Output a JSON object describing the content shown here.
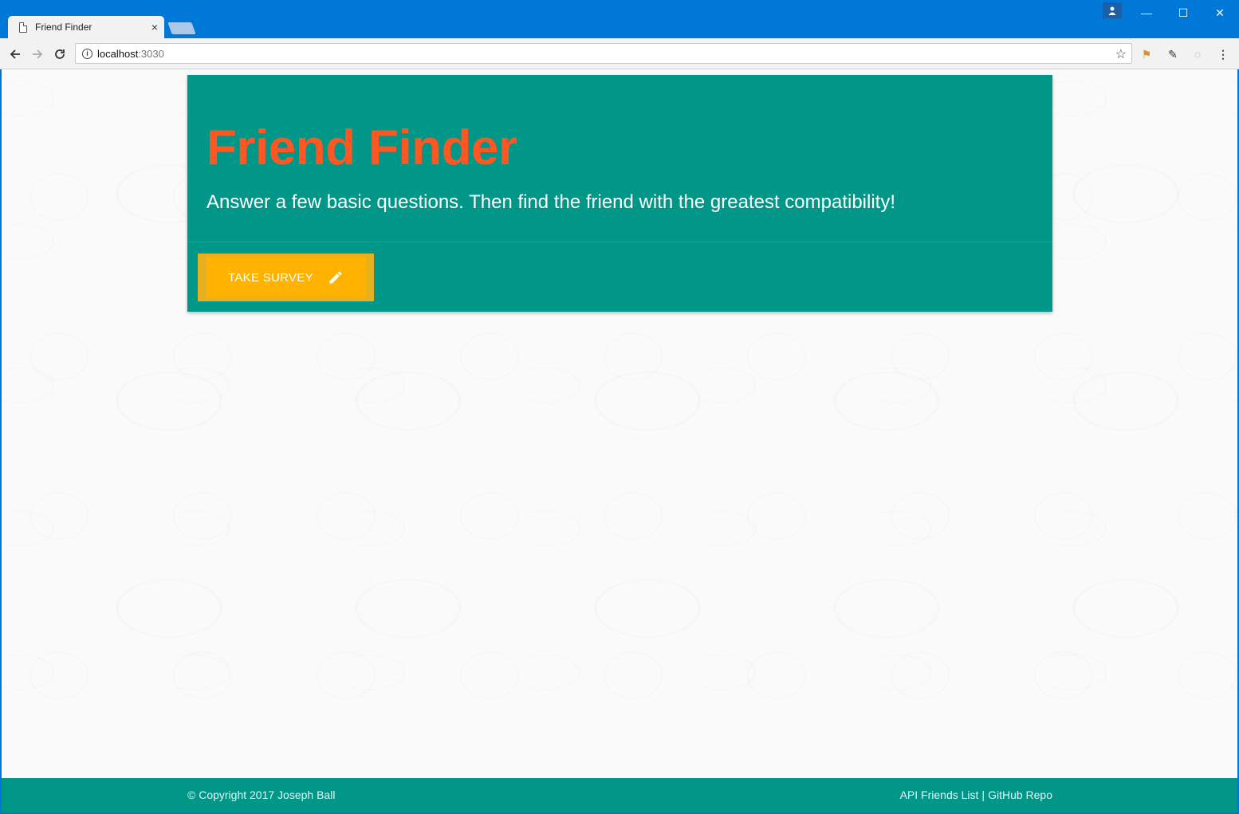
{
  "browser": {
    "tab_title": "Friend Finder",
    "tab_close": "×",
    "url_host": "localhost",
    "url_port": ":3030",
    "window_controls": {
      "minimize": "—",
      "maximize": "☐",
      "close": "✕"
    },
    "icons": [
      "back-icon",
      "forward-icon",
      "reload-icon",
      "info-icon",
      "star-icon",
      "menu-icon"
    ]
  },
  "hero": {
    "title": "Friend Finder",
    "subtitle": "Answer a few basic questions. Then find the friend with the greatest compatibility!",
    "button_label": "TAKE SURVEY",
    "button_icon": "pencil-icon"
  },
  "footer": {
    "copyright": "© Copyright 2017 Joseph Ball",
    "link_api": "API Friends List",
    "separator": "|",
    "link_github": "GitHub Repo"
  },
  "colors": {
    "primary": "#009688",
    "title": "#ff5722",
    "button": "#ffb300",
    "chrome": "#0078d7"
  }
}
